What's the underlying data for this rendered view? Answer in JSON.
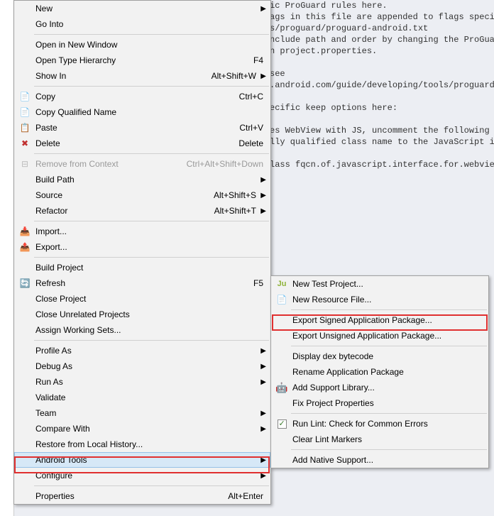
{
  "editor": {
    "line1": "ic ProGuard rules here.",
    "line2": "ags in this file are appended to flags specif",
    "line3": "s/proguard/proguard-android.txt",
    "line4": "nclude path and order by changing the ProGuar",
    "line5": "n project.properties.",
    "line6": "",
    "line7": "see",
    "line8": ".android.com/guide/developing/tools/proguard.",
    "line9": "",
    "line10": "ecific keep options here:",
    "line11": "",
    "line12": "es WebView with JS, uncomment the following",
    "line13": "lly qualified class name to the JavaScript in",
    "line14": "",
    "line15": "lass fqcn.of.javascript.interface.for.webview"
  },
  "menu": {
    "new": "New",
    "go_into": "Go Into",
    "open_new_window": "Open in New Window",
    "open_type_hierarchy": "Open Type Hierarchy",
    "open_type_hierarchy_key": "F4",
    "show_in": "Show In",
    "show_in_key": "Alt+Shift+W",
    "copy": "Copy",
    "copy_key": "Ctrl+C",
    "copy_qualified": "Copy Qualified Name",
    "paste": "Paste",
    "paste_key": "Ctrl+V",
    "delete": "Delete",
    "delete_key": "Delete",
    "remove_context": "Remove from Context",
    "remove_context_key": "Ctrl+Alt+Shift+Down",
    "build_path": "Build Path",
    "source": "Source",
    "source_key": "Alt+Shift+S",
    "refactor": "Refactor",
    "refactor_key": "Alt+Shift+T",
    "import": "Import...",
    "export": "Export...",
    "build_project": "Build Project",
    "refresh": "Refresh",
    "refresh_key": "F5",
    "close_project": "Close Project",
    "close_unrelated": "Close Unrelated Projects",
    "assign_working": "Assign Working Sets...",
    "profile_as": "Profile As",
    "debug_as": "Debug As",
    "run_as": "Run As",
    "validate": "Validate",
    "team": "Team",
    "compare_with": "Compare With",
    "restore_history": "Restore from Local History...",
    "android_tools": "Android Tools",
    "configure": "Configure",
    "properties": "Properties",
    "properties_key": "Alt+Enter"
  },
  "submenu": {
    "new_test": "New Test Project...",
    "new_resource": "New Resource File...",
    "export_signed": "Export Signed Application Package...",
    "export_unsigned": "Export Unsigned Application Package...",
    "display_dex": "Display dex bytecode",
    "rename_pkg": "Rename Application Package",
    "add_support": "Add Support Library...",
    "fix_properties": "Fix Project Properties",
    "run_lint": "Run Lint: Check for Common Errors",
    "clear_lint": "Clear Lint Markers",
    "add_native": "Add Native Support..."
  }
}
